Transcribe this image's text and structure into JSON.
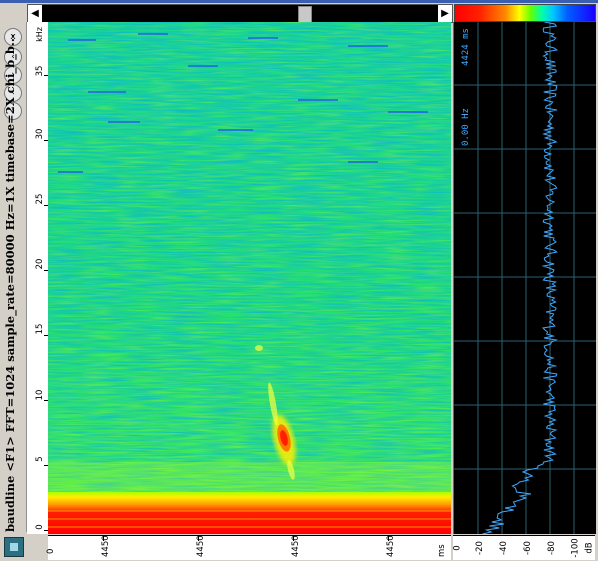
{
  "window": {
    "status_line": "baudline <F1> FFT=1024 sample_rate=80000 Hz=1X timebase=2X chi_b_b..."
  },
  "nav_buttons": [
    {
      "label": "x",
      "icon": "close-icon"
    },
    {
      "label": "‹",
      "icon": "chevron-left-icon"
    },
    {
      "label": "›",
      "icon": "chevron-right-icon"
    },
    {
      "label": "‹",
      "icon": "chevron-left-icon"
    },
    {
      "label": "›",
      "icon": "chevron-right-icon"
    }
  ],
  "frequency_axis": {
    "unit": "kHz",
    "ticks": [
      "0",
      "5",
      "10",
      "15",
      "20",
      "25",
      "30",
      "35"
    ]
  },
  "time_axis": {
    "unit": "ms",
    "labels": [
      "4450",
      "4450",
      "4450",
      "4450",
      "4450",
      "4450"
    ],
    "first": "0"
  },
  "spectrum_panel": {
    "time_readout": "4424 ms",
    "freq_readout": "0.00 Hz"
  },
  "db_axis": {
    "unit": "dB",
    "labels": [
      "0",
      "-20",
      "-40",
      "-60",
      "-80",
      "-100"
    ]
  },
  "colors": {
    "background_noise": "#20e070",
    "low_band": "#ff1a00",
    "spectrum_trace": "#3fa9ff",
    "panel_bg": "#000000"
  }
}
